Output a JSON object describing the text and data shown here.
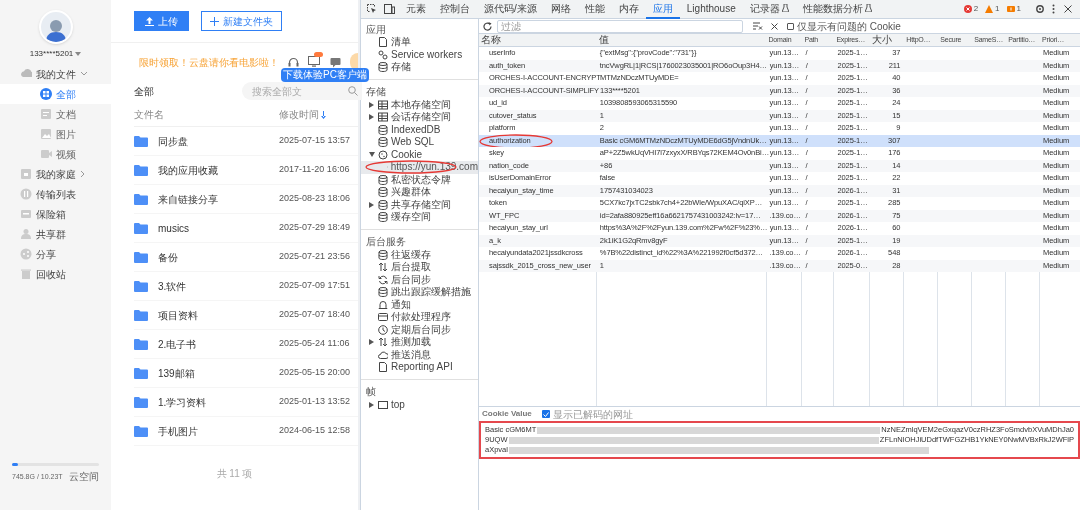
{
  "app": {
    "user": {
      "name": "133****5201"
    },
    "nav": [
      {
        "label": "我的文件",
        "expanded": true,
        "children": [
          {
            "label": "全部",
            "selected": true
          },
          {
            "label": "文档",
            "selected": false
          },
          {
            "label": "图片",
            "selected": false
          },
          {
            "label": "视频",
            "selected": false
          }
        ]
      },
      {
        "label": "我的家庭",
        "expanded": false
      },
      {
        "label": "传输列表"
      },
      {
        "label": "保险箱"
      },
      {
        "label": "共享群"
      },
      {
        "label": "分享"
      },
      {
        "label": "回收站"
      }
    ],
    "storage": {
      "level": 0.07,
      "usage": "745.8G / 10.23T",
      "label": "云空间"
    },
    "buttons": [
      {
        "label": "上传",
        "kind": "primary"
      },
      {
        "label": "新建文件夹",
        "kind": "outline"
      }
    ],
    "promo": "限时领取！云盘请你看电影啦！",
    "tooltip": "下载体验PC客户端",
    "breadcrumb": "全部",
    "search": {
      "placeholder": "搜索全部文"
    },
    "columns": [
      "文件名",
      "修改时间"
    ],
    "files": [
      {
        "name": "同步盘",
        "modified": "2025-07-15 13:57"
      },
      {
        "name": "我的应用收藏",
        "modified": "2017-11-20 16:06"
      },
      {
        "name": "来自链接分享",
        "modified": "2025-08-23 18:06"
      },
      {
        "name": "musics",
        "modified": "2025-07-29 18:49"
      },
      {
        "name": "备份",
        "modified": "2025-07-21 23:56"
      },
      {
        "name": "3.软件",
        "modified": "2025-07-09 17:51"
      },
      {
        "name": "项目资料",
        "modified": "2025-07-07 18:40"
      },
      {
        "name": "2.电子书",
        "modified": "2025-05-24 11:06"
      },
      {
        "name": "139邮箱",
        "modified": "2025-05-15 20:00"
      },
      {
        "name": "1.学习资料",
        "modified": "2025-01-13 13:52"
      },
      {
        "name": "手机图片",
        "modified": "2024-06-15 12:58"
      }
    ],
    "footer": "共 11 项"
  },
  "devtools": {
    "tabs": [
      {
        "label": "元素",
        "selected": false
      },
      {
        "label": "控制台",
        "selected": false
      },
      {
        "label": "源代码/来源",
        "selected": false
      },
      {
        "label": "网络",
        "selected": false
      },
      {
        "label": "性能",
        "selected": false
      },
      {
        "label": "内存",
        "selected": false
      },
      {
        "label": "应用",
        "selected": true
      },
      {
        "label": "Lighthouse",
        "selected": false
      },
      {
        "label": "记录器",
        "selected": false,
        "experimental": true
      },
      {
        "label": "性能数据分析",
        "selected": false,
        "experimental": true
      }
    ],
    "counters": [
      {
        "kind": "error",
        "count": "2"
      },
      {
        "kind": "warning",
        "count": "1"
      },
      {
        "kind": "issue",
        "count": "1"
      }
    ],
    "sidebar": [
      {
        "title": "应用",
        "items": [
          {
            "label": "清单"
          },
          {
            "label": "Service workers"
          },
          {
            "label": "存储"
          }
        ]
      },
      {
        "title": "存储",
        "items": [
          {
            "label": "本地存储空间",
            "expanded": false
          },
          {
            "label": "会话存储空间",
            "expanded": false
          },
          {
            "label": "IndexedDB"
          },
          {
            "label": "Web SQL"
          },
          {
            "label": "Cookie",
            "expanded": true,
            "children": [
              {
                "label": "https://yun.139.com",
                "selected": true,
                "circled": true
              }
            ]
          },
          {
            "label": "私密状态令牌"
          },
          {
            "label": "兴趣群体"
          },
          {
            "label": "共享存储空间",
            "expanded": false
          },
          {
            "label": "缓存空间"
          }
        ]
      },
      {
        "title": "后台服务",
        "items": [
          {
            "label": "往返缓存"
          },
          {
            "label": "后台提取"
          },
          {
            "label": "后台同步"
          },
          {
            "label": "跳出跟踪缓解措施"
          },
          {
            "label": "通知"
          },
          {
            "label": "付款处理程序"
          },
          {
            "label": "定期后台同步"
          },
          {
            "label": "推测加载",
            "expanded": false
          },
          {
            "label": "推送消息"
          },
          {
            "label": "Reporting API"
          }
        ]
      },
      {
        "title": "帧",
        "items": [
          {
            "label": "top",
            "expanded": false
          }
        ]
      }
    ],
    "filter": {
      "placeholder": "过滤",
      "only_issues": {
        "label": "仅显示有问题的 Cookie",
        "checked": false
      }
    },
    "columns": [
      "名称",
      "值",
      "Domain",
      "Path",
      "Expires…",
      "大小",
      "HttpO…",
      "Secure",
      "SameS…",
      "Partitio…",
      "Priori…"
    ],
    "rows": [
      {
        "name": "userInfo",
        "value": "{\"extMsg\":{\"provCode\":\"731\"}}",
        "domain": "yun.13…",
        "path": "/",
        "expires": "2025-1…",
        "size": "37",
        "priority": "Medium",
        "selected": false
      },
      {
        "name": "auth_token",
        "value": "tncVwgRL|1|RCS|1760023035001|RO6oOup3H4…",
        "domain": "yun.13…",
        "path": "/",
        "expires": "2025-1…",
        "size": "211",
        "priority": "Medium",
        "selected": false
      },
      {
        "name": "ORCHES-I-ACCOUNT-ENCRYPT",
        "value": "MTMzNDczMTUyMDE=",
        "domain": "yun.13…",
        "path": "/",
        "expires": "2025-1…",
        "size": "40",
        "priority": "Medium",
        "selected": false
      },
      {
        "name": "ORCHES-I-ACCOUNT-SIMPLIFY",
        "value": "133****5201",
        "domain": "yun.13…",
        "path": "/",
        "expires": "2025-1…",
        "size": "36",
        "priority": "Medium",
        "selected": false
      },
      {
        "name": "ud_id",
        "value": "1039808593065315590",
        "domain": "yun.13…",
        "path": "/",
        "expires": "2025-1…",
        "size": "24",
        "priority": "Medium",
        "selected": false
      },
      {
        "name": "cutover_status",
        "value": "1",
        "domain": "yun.13…",
        "path": "/",
        "expires": "2025-1…",
        "size": "15",
        "priority": "Medium",
        "selected": false
      },
      {
        "name": "platform",
        "value": "2",
        "domain": "yun.13…",
        "path": "/",
        "expires": "2025-1…",
        "size": "9",
        "priority": "Medium",
        "selected": false
      },
      {
        "name": "authorization",
        "value": "Basic cGM6MTMzNDczMTUyMDE6dG5jVndnUk…",
        "domain": "yun.13…",
        "path": "/",
        "expires": "2025-1…",
        "size": "307",
        "priority": "Medium",
        "selected": true,
        "circled": true
      },
      {
        "name": "skey",
        "value": "aP+2Z5wkUqVHI7l7zxyxX/RBYqs72KEM4Ov0nBi…",
        "domain": "yun.13…",
        "path": "/",
        "expires": "2025-1…",
        "size": "176",
        "priority": "Medium",
        "selected": false
      },
      {
        "name": "nation_code",
        "value": "+86",
        "domain": "yun.13…",
        "path": "/",
        "expires": "2025-1…",
        "size": "14",
        "priority": "Medium",
        "selected": false
      },
      {
        "name": "isUserDomainError",
        "value": "false",
        "domain": "yun.13…",
        "path": "/",
        "expires": "2025-1…",
        "size": "22",
        "priority": "Medium",
        "selected": false
      },
      {
        "name": "hecaiyun_stay_time",
        "value": "1757431034023",
        "domain": "yun.13…",
        "path": "/",
        "expires": "2026-1…",
        "size": "31",
        "priority": "Medium",
        "selected": false
      },
      {
        "name": "token",
        "value": "5CX7kc7jxTC2sbk7ch4+22bWle/WpuXAC/qiXP…",
        "domain": "yun.13…",
        "path": "/",
        "expires": "2025-1…",
        "size": "285",
        "priority": "Medium",
        "selected": false
      },
      {
        "name": "WT_FPC",
        "value": "id=2afa880925eff16a6621757431003242:lv=17…",
        "domain": ".139.co…",
        "path": "/",
        "expires": "2026-1…",
        "size": "75",
        "priority": "Medium",
        "selected": false
      },
      {
        "name": "hecaiyun_stay_url",
        "value": "https%3A%2F%2Fyun.139.com%2Fw%2F%23%…",
        "domain": "yun.13…",
        "path": "/",
        "expires": "2026-1…",
        "size": "60",
        "priority": "Medium",
        "selected": false
      },
      {
        "name": "a_k",
        "value": "2k1iK1G2qRmv8gyF",
        "domain": "yun.13…",
        "path": "/",
        "expires": "2025-1…",
        "size": "19",
        "priority": "Medium",
        "selected": false
      },
      {
        "name": "hecaiyundata2021jssdkcross",
        "value": "%7B%22distinct_id%22%3A%221992f0cf5d372…",
        "domain": ".139.co…",
        "path": "/",
        "expires": "2026-1…",
        "size": "548",
        "priority": "Medium",
        "selected": false
      },
      {
        "name": "sajssdk_2015_cross_new_user",
        "value": "1",
        "domain": ".139.co…",
        "path": "/",
        "expires": "2025-0…",
        "size": "28",
        "priority": "Medium",
        "selected": false
      }
    ],
    "cookie_value": {
      "title": "Cookie Value",
      "decode": {
        "label": "显示已解码的网址",
        "checked": true
      },
      "outlined": true,
      "lines": [
        [
          {
            "kind": "text",
            "text": "Basic cGM6MT"
          },
          {
            "kind": "redacted"
          },
          {
            "kind": "text",
            "text": "NzNEZmlqVEM2eGxqazV0czRHZ3FoSmdvbXVuMDhJa0"
          }
        ],
        [
          {
            "kind": "text",
            "text": "9UQW"
          },
          {
            "kind": "redacted"
          },
          {
            "kind": "text",
            "text": "ZFLnNlOHJiUDdfTWFGZHB1YkNEY0NwMVBxRkJ2WFlP"
          }
        ],
        [
          {
            "kind": "text",
            "text": "aXpval"
          },
          {
            "kind": "redacted"
          }
        ]
      ]
    }
  }
}
